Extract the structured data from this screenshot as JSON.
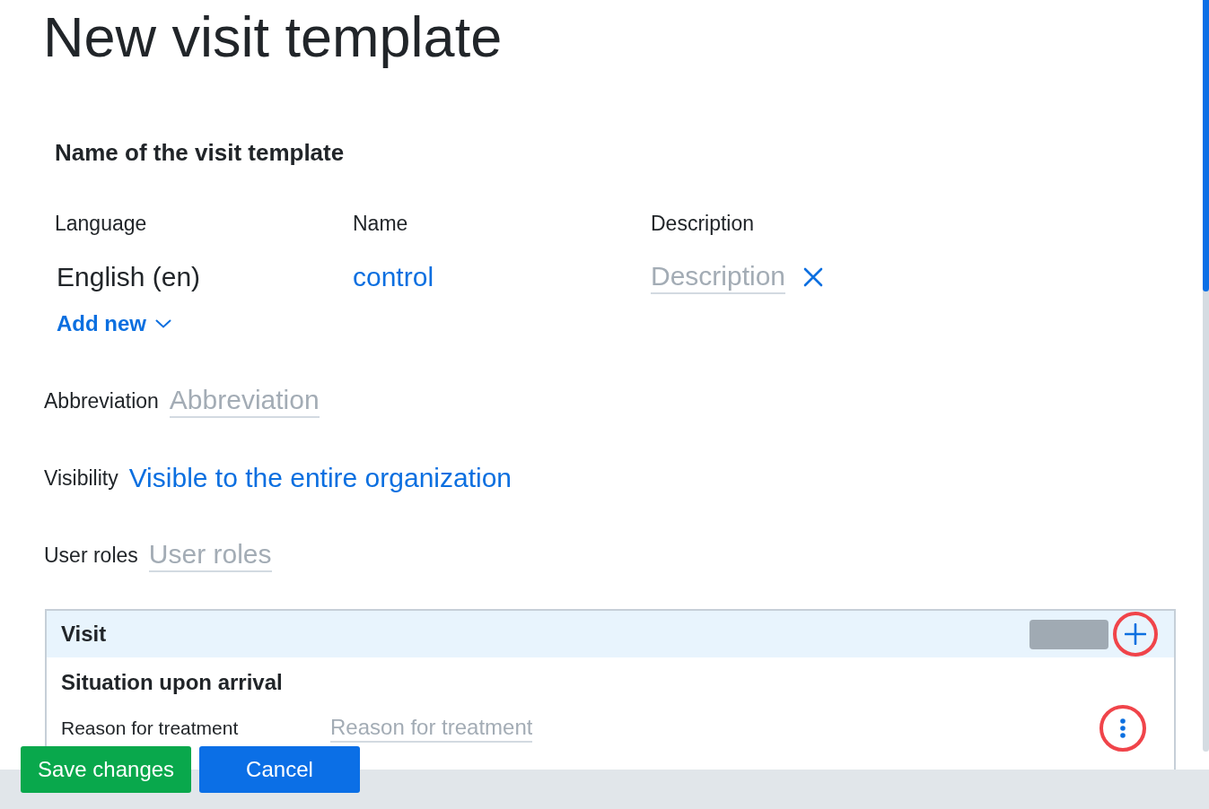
{
  "page": {
    "title": "New visit template"
  },
  "translations": {
    "heading": "Name of the visit template",
    "columns": [
      "Language",
      "Name",
      "Description"
    ],
    "rows": [
      {
        "language": "English (en)",
        "name": "control",
        "description": {
          "placeholder": "Description"
        },
        "removable": true
      }
    ],
    "add_button": "Add new"
  },
  "fields": [
    {
      "kind": "input",
      "label": "Abbreviation",
      "placeholder": "Abbreviation"
    },
    {
      "kind": "link",
      "label": "Visibility",
      "value": "Visible to the entire organization"
    },
    {
      "kind": "input",
      "label": "User roles",
      "placeholder": "User roles"
    }
  ],
  "panel": {
    "title": "Visit",
    "add_highlighted": true,
    "sections": [
      {
        "title": "Situation upon arrival",
        "fields": [
          {
            "label": "Reason for treatment",
            "placeholder": "Reason for treatment",
            "menu_highlighted": true
          }
        ]
      }
    ]
  },
  "actions": [
    {
      "label": "Save changes",
      "kind": "success"
    },
    {
      "label": "Cancel",
      "kind": "primary"
    }
  ]
}
